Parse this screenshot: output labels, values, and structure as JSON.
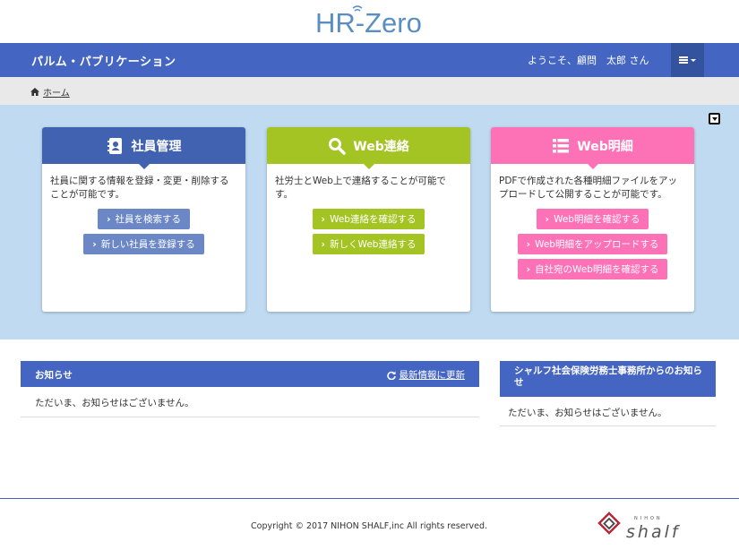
{
  "header": {
    "logo_text": "HR-Zero",
    "app_title": "パルム・パブリケーション",
    "welcome": "ようこそ、顧問　太郎 さん",
    "menu_icon": "bars-icon"
  },
  "breadcrumb": {
    "items": [
      {
        "label": "ホーム",
        "icon": "home-icon"
      }
    ]
  },
  "cards": {
    "employee": {
      "title": "社員管理",
      "icon": "address-book-icon",
      "description": "社員に関する情報を登録・変更・削除することが可能です。",
      "buttons": [
        "社員を検索する",
        "新しい社員を登録する"
      ]
    },
    "web_contact": {
      "title": "Web連絡",
      "icon": "search-icon",
      "description": "社労士とWeb上で連絡することが可能です。",
      "buttons": [
        "Web連絡を確認する",
        "新しくWeb連絡する"
      ]
    },
    "web_payslip": {
      "title": "Web明細",
      "icon": "list-icon",
      "description": "PDFで作成された各種明細ファイルをアップロードして公開することが可能です。",
      "buttons": [
        "Web明細を確認する",
        "Web明細をアップロードする",
        "自社宛のWeb明細を確認する"
      ]
    }
  },
  "notice": {
    "title": "お知らせ",
    "refresh_label": "最新情報に更新",
    "empty_message": "ただいま、お知らせはございません。"
  },
  "shalf_notice": {
    "title": "シャルフ社会保険労務士事務所からのお知らせ",
    "empty_message": "ただいま、お知らせはございません。"
  },
  "footer": {
    "copyright": "Copyright © 2017 NIHON SHALF,inc All rights reserved.",
    "logo_text": "shalf",
    "logo_small_text": "NIHON"
  },
  "colors": {
    "navbar": "#4565c3",
    "hero_bg": "#bfdaf1",
    "employee": "#4062b0",
    "web_contact": "#a3c423",
    "web_payslip": "#fd71b7"
  }
}
